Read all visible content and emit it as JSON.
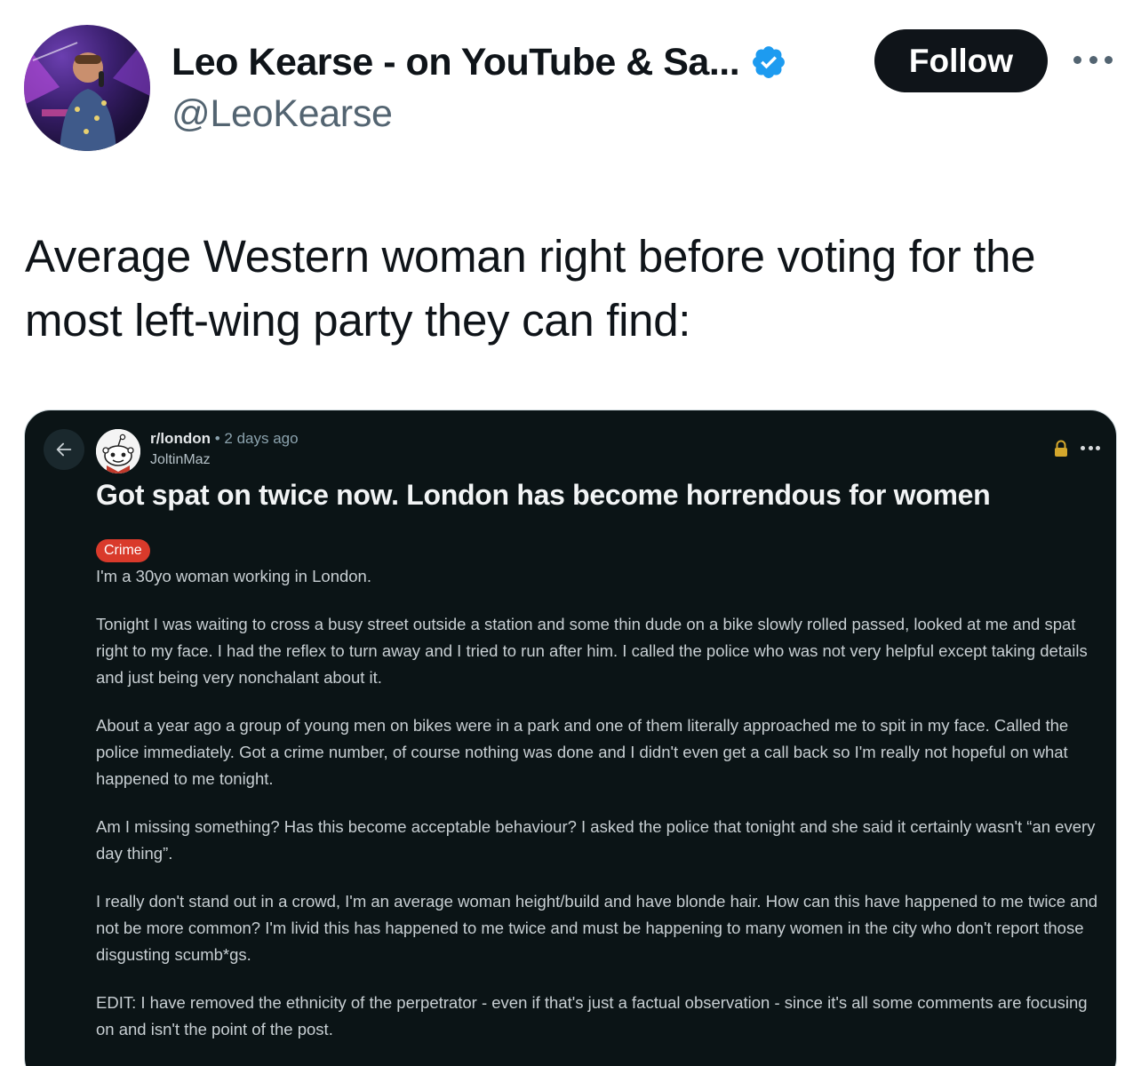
{
  "tweet": {
    "display_name": "Leo Kearse - on YouTube & Sa...",
    "handle": "@LeoKearse",
    "follow_label": "Follow",
    "text": "Average Western woman right before voting for the most left-wing party they can find:"
  },
  "reddit_post": {
    "subreddit": "r/london",
    "separator": "•",
    "time": "2 days ago",
    "author": "JoltinMaz",
    "title": "Got spat on twice now. London has become horrendous for women",
    "flair": "Crime",
    "paragraphs": [
      "I'm a 30yo woman working in London.",
      "Tonight I was waiting to cross a busy street outside a station and some thin dude on a bike slowly rolled passed, looked at me and spat right to my face. I had the reflex to turn away and I tried to run after him. I called the police who was not very helpful except taking details and just being very nonchalant about it.",
      "About a year ago a group of young men on bikes were in a park and one of them literally approached me to spit in my face. Called the police immediately. Got a crime number, of course nothing was done and I didn't even get a call back so I'm really not hopeful on what happened to me tonight.",
      "Am I missing something? Has this become acceptable behaviour? I asked the police that tonight and she said it certainly wasn't “an every day thing”.",
      "I really don't stand out in a crowd, I'm an average woman height/build and have blonde hair. How can this have happened to me twice and not be more common? I'm livid this has happened to me twice and must be happening to many women in the city who don't report those disgusting scumb*gs.",
      "EDIT: I have removed the ethnicity of the perpetrator - even if that's just a factual observation - since it's all some comments are focusing on and isn't the point of the post."
    ]
  },
  "icons": {
    "verified": "verified-badge-icon",
    "more": "more-horizontal-icon",
    "back": "arrow-left-icon",
    "lock": "lock-icon",
    "subreddit_avatar": "reddit-snoo-icon"
  },
  "colors": {
    "follow_bg": "#0f1419",
    "verified": "#1d9bf0",
    "media_bg": "#0b1416",
    "flair_bg": "#d93a2b",
    "lock": "#d4a72c"
  }
}
